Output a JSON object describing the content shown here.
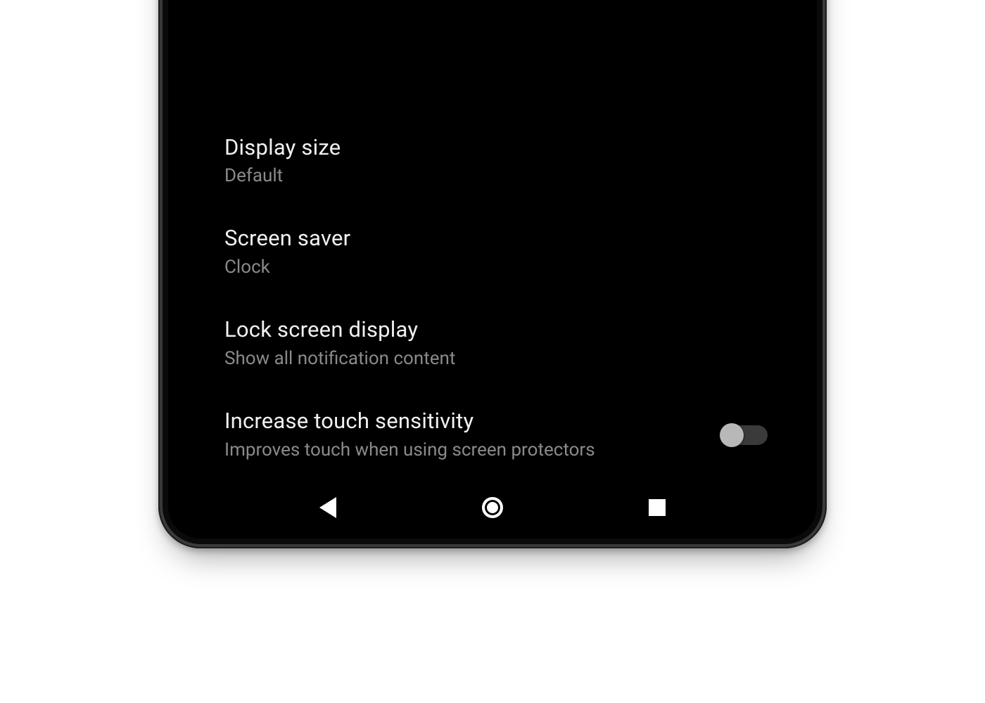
{
  "settings": {
    "items": [
      {
        "title": "Display size",
        "subtitle": "Default"
      },
      {
        "title": "Screen saver",
        "subtitle": "Clock"
      },
      {
        "title": "Lock screen display",
        "subtitle": "Show all notification content"
      },
      {
        "title": "Increase touch sensitivity",
        "subtitle": "Improves touch when using screen protectors",
        "toggle": false
      }
    ]
  }
}
